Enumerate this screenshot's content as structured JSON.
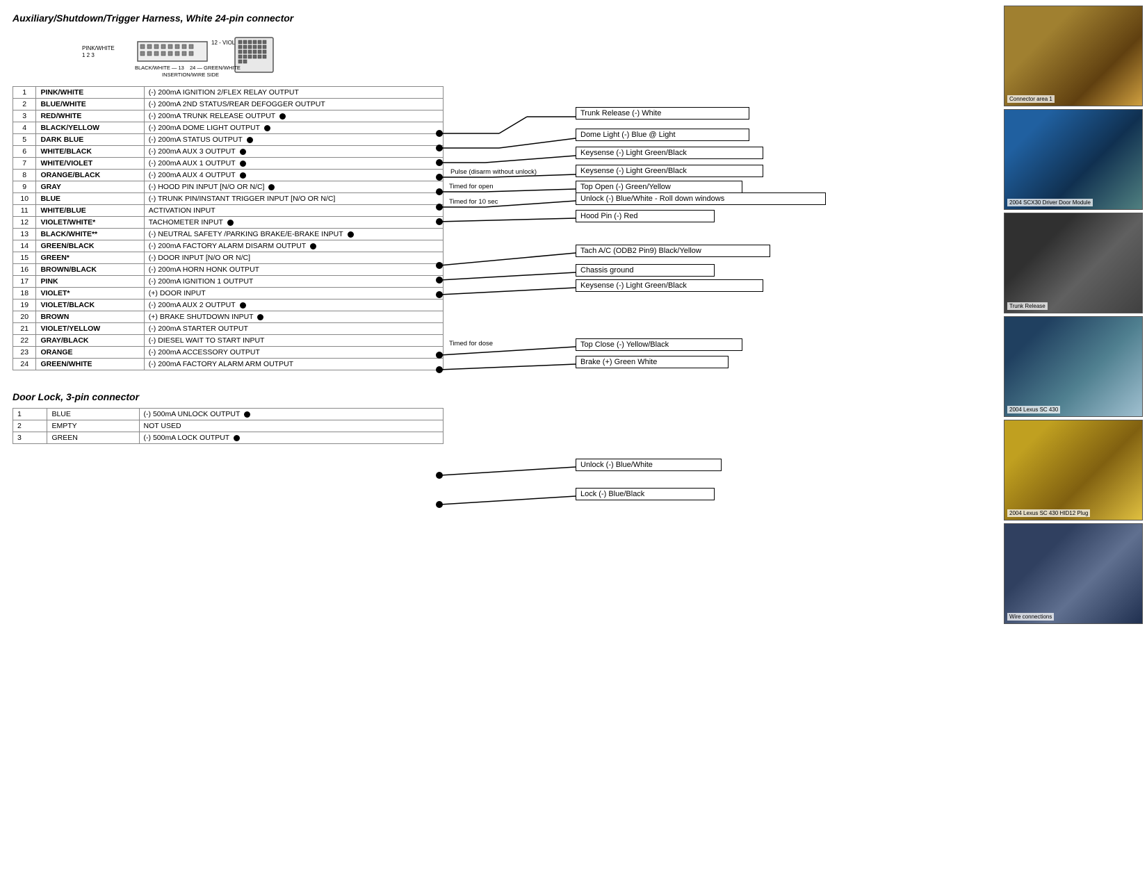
{
  "title": "Auxiliary/Shutdown/Trigger Harness, White 24-pin connector",
  "door_lock_title": "Door Lock, 3-pin connector",
  "main_table": {
    "rows": [
      {
        "num": "1",
        "wire": "PINK/WHITE",
        "desc": "(-) 200mA IGNITION 2/FLEX RELAY OUTPUT",
        "dot": false
      },
      {
        "num": "2",
        "wire": "BLUE/WHITE",
        "desc": "(-) 200mA 2ND STATUS/REAR DEFOGGER OUTPUT",
        "dot": false
      },
      {
        "num": "3",
        "wire": "RED/WHITE",
        "desc": "(-) 200mA TRUNK RELEASE OUTPUT",
        "dot": true
      },
      {
        "num": "4",
        "wire": "BLACK/YELLOW",
        "desc": "(-) 200mA DOME LIGHT OUTPUT",
        "dot": true
      },
      {
        "num": "5",
        "wire": "DARK BLUE",
        "desc": "(-) 200mA STATUS OUTPUT",
        "dot": true
      },
      {
        "num": "6",
        "wire": "WHITE/BLACK",
        "desc": "(-) 200mA AUX 3 OUTPUT",
        "dot": true
      },
      {
        "num": "7",
        "wire": "WHITE/VIOLET",
        "desc": "(-) 200mA AUX 1 OUTPUT",
        "dot": true
      },
      {
        "num": "8",
        "wire": "ORANGE/BLACK",
        "desc": "(-) 200mA AUX 4 OUTPUT",
        "dot": true
      },
      {
        "num": "9",
        "wire": "GRAY",
        "desc": "(-) HOOD PIN INPUT [N/O OR N/C]",
        "dot": true
      },
      {
        "num": "10",
        "wire": "BLUE",
        "desc": "(-) TRUNK PIN/INSTANT TRIGGER INPUT [N/O OR N/C]",
        "dot": false
      },
      {
        "num": "11",
        "wire": "WHITE/BLUE",
        "desc": "ACTIVATION INPUT",
        "dot": false
      },
      {
        "num": "12",
        "wire": "VIOLET/WHITE*",
        "desc": "TACHOMETER INPUT",
        "dot": true
      },
      {
        "num": "13",
        "wire": "BLACK/WHITE**",
        "desc": "(-) NEUTRAL SAFETY /PARKING BRAKE/E-BRAKE INPUT",
        "dot": true
      },
      {
        "num": "14",
        "wire": "GREEN/BLACK",
        "desc": "(-) 200mA FACTORY ALARM DISARM OUTPUT",
        "dot": true
      },
      {
        "num": "15",
        "wire": "GREEN*",
        "desc": "(-) DOOR INPUT [N/O OR N/C]",
        "dot": false
      },
      {
        "num": "16",
        "wire": "BROWN/BLACK",
        "desc": "(-) 200mA HORN HONK OUTPUT",
        "dot": false
      },
      {
        "num": "17",
        "wire": "PINK",
        "desc": "(-) 200mA IGNITION 1 OUTPUT",
        "dot": false
      },
      {
        "num": "18",
        "wire": "VIOLET*",
        "desc": "(+) DOOR INPUT",
        "dot": false
      },
      {
        "num": "19",
        "wire": "VIOLET/BLACK",
        "desc": "(-) 200mA AUX 2 OUTPUT",
        "dot": true
      },
      {
        "num": "20",
        "wire": "BROWN",
        "desc": "(+) BRAKE SHUTDOWN INPUT",
        "dot": true
      },
      {
        "num": "21",
        "wire": "VIOLET/YELLOW",
        "desc": "(-) 200mA STARTER OUTPUT",
        "dot": false
      },
      {
        "num": "22",
        "wire": "GRAY/BLACK",
        "desc": "(-) DIESEL WAIT TO START INPUT",
        "dot": false
      },
      {
        "num": "23",
        "wire": "ORANGE",
        "desc": "(-) 200mA ACCESSORY OUTPUT",
        "dot": false
      },
      {
        "num": "24",
        "wire": "GREEN/WHITE",
        "desc": "(-) 200mA FACTORY ALARM ARM OUTPUT",
        "dot": false
      }
    ]
  },
  "door_lock_table": {
    "rows": [
      {
        "num": "1",
        "wire": "BLUE",
        "desc": "(-) 500mA UNLOCK OUTPUT",
        "dot": true
      },
      {
        "num": "2",
        "wire": "EMPTY",
        "desc": "NOT USED",
        "dot": false
      },
      {
        "num": "3",
        "wire": "GREEN",
        "desc": "(-) 500mA LOCK OUTPUT",
        "dot": true
      }
    ]
  },
  "callouts": {
    "trunk_release": "Trunk Release (-) White",
    "dome_light": "Dome Light (-) Blue @ Light",
    "keysense_1": "Keysense (-) Light Green/Black",
    "pulse_disarm": "Pulse (disarm without unlock)",
    "keysense_2": "Keysense (-) Light Green/Black",
    "timed_open": "Timed for open",
    "top_open": "Top Open (-) Green/Yellow",
    "timed_10": "Timed for 10 sec",
    "unlock": "Unlock (-) Blue/White - Roll down windows",
    "hood_pin": "Hood Pin (-) Red",
    "tach": "Tach A/C (ODB2 Pin9) Black/Yellow",
    "chassis_ground": "Chassis ground",
    "keysense_3": "Keysense (-) Light Green/Black",
    "timed_close": "Timed for dose",
    "top_close": "Top Close (-) Yellow/Black",
    "brake": "Brake (+) Green White",
    "unlock_door": "Unlock (-) Blue/White",
    "lock_door": "Lock (-) Blue/Black"
  },
  "photos": [
    {
      "label": "Connector area 1"
    },
    {
      "label": "2004 SCX30 Driver Door Module"
    },
    {
      "label": "Trunk Release"
    },
    {
      "label": "2004 Lexus SC 430"
    },
    {
      "label": "2004 Lexus SC 430 HID12 Plug"
    },
    {
      "label": "Wire connections"
    }
  ]
}
